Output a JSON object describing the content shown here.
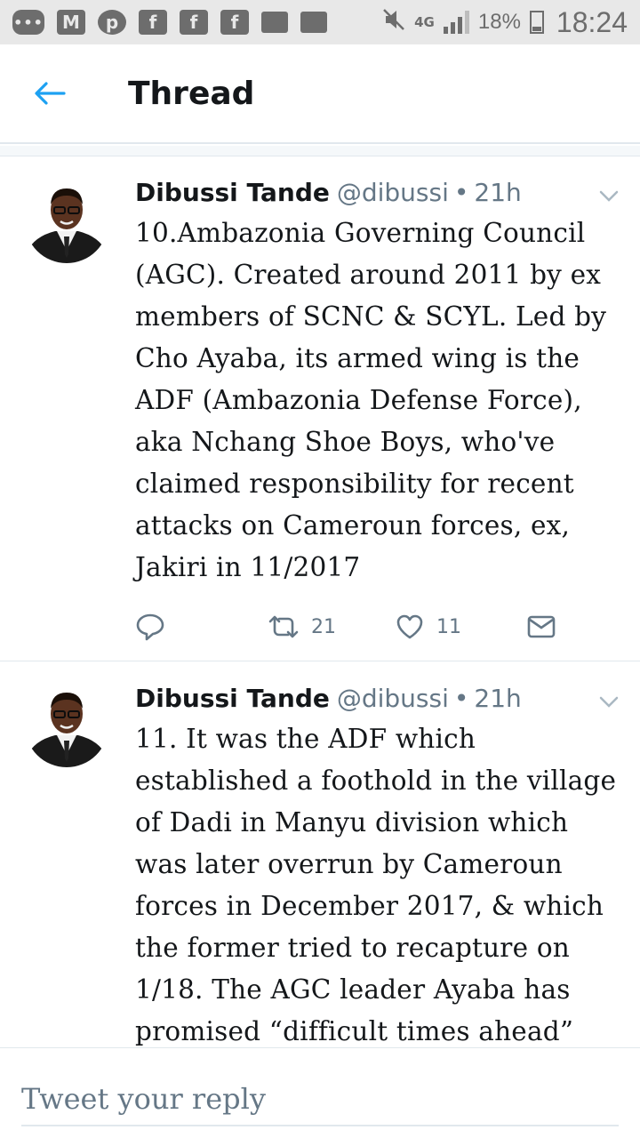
{
  "status_bar": {
    "icons": [
      "more-icon",
      "gmail-icon",
      "pinterest-icon",
      "facebook-icon",
      "facebook-icon",
      "facebook-icon",
      "chat-icon",
      "chat-icon"
    ],
    "network": "4G",
    "battery": "18%",
    "time": "18:24"
  },
  "header": {
    "title": "Thread"
  },
  "tweets": [
    {
      "name": "Dibussi Tande",
      "handle": "@dibussi",
      "dot": "•",
      "time": "21h",
      "text": "10.Ambazonia Governing Council (AGC). Created around 2011 by ex members of SCNC & SCYL. Led by Cho Ayaba, its armed wing is the ADF (Ambazonia Defense Force), aka Nchang Shoe Boys, who've claimed responsibility for recent attacks on Cameroun forces, ex, Jakiri in 11/2017",
      "retweets": "21",
      "likes": "11"
    },
    {
      "name": "Dibussi Tande",
      "handle": "@dibussi",
      "dot": "•",
      "time": "21h",
      "text": "11. It was the ADF which established a foothold in the village of Dadi in Manyu division which was later overrun by Cameroun forces in December 2017, & which the former tried to recapture on 1/18. The AGC leader Ayaba has promised “difficult times ahead” for"
    }
  ],
  "reply": {
    "placeholder": "Tweet your reply"
  },
  "colors": {
    "accent": "#1da1f2",
    "text": "#14171a",
    "secondary": "#657786",
    "divider": "#e1e8ed"
  }
}
